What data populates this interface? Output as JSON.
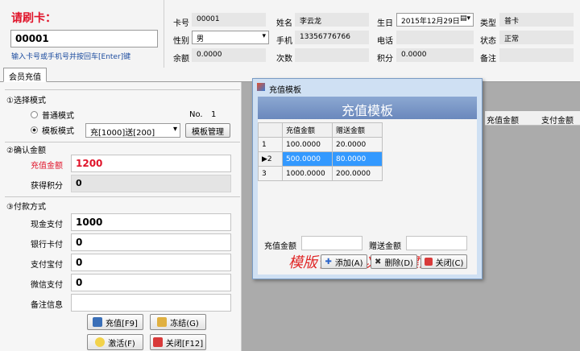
{
  "card": {
    "label": "请刷卡：",
    "number": "00001",
    "hint": "输入卡号或手机号并按回车[Enter]键"
  },
  "info": {
    "card_no_label": "卡号",
    "card_no": "00001",
    "name_label": "姓名",
    "name": "李云龙",
    "birthday_label": "生日",
    "birthday": "2015年12月29日",
    "type_label": "类型",
    "type": "普卡",
    "gender_label": "性别",
    "gender": "男",
    "phone_label": "手机",
    "phone": "13356776766",
    "tel_label": "电话",
    "tel": "",
    "status_label": "状态",
    "status": "正常",
    "balance_label": "余额",
    "balance": "0.0000",
    "times_label": "次数",
    "times": "",
    "points_label": "积分",
    "points": "0.0000",
    "note_label": "备注",
    "note": ""
  },
  "tab": {
    "label": "会员充值"
  },
  "mode": {
    "section": "①选择模式",
    "normal_label": "普通模式",
    "template_label": "模板模式",
    "no_label": "No.",
    "no_value": "1",
    "template_select": "充[1000]送[200]",
    "template_mgmt_button": "模板管理"
  },
  "amount": {
    "section": "②确认金额",
    "charge_label": "充值金额",
    "charge_value": "1200",
    "points_label": "获得积分",
    "points_value": "0"
  },
  "payment": {
    "section": "③付款方式",
    "cash_label": "现金支付",
    "cash_value": "1000",
    "bank_label": "银行卡付",
    "bank_value": "0",
    "alipay_label": "支付宝付",
    "alipay_value": "0",
    "wechat_label": "微信支付",
    "wechat_value": "0",
    "note_label": "备注信息",
    "note_value": ""
  },
  "buttons": {
    "recharge": "充值[F9]",
    "freeze": "冻结(G)",
    "activate": "激活(F)",
    "close": "关闭[F12]"
  },
  "grid": {
    "col_amount": "充值金额",
    "col_pay": "支付金额"
  },
  "dialog": {
    "title": "充值模板",
    "banner": "充值模板",
    "columns": [
      "充值金额",
      "赠送金额"
    ],
    "rows": [
      {
        "no": "1",
        "charge": "100.0000",
        "gift": "20.0000"
      },
      {
        "no": "2",
        "charge": "500.0000",
        "gift": "80.0000"
      },
      {
        "no": "3",
        "charge": "1000.0000",
        "gift": "200.0000"
      }
    ],
    "promo": "模版管理可以随时建立",
    "charge_label": "充值金额",
    "charge_value": "",
    "gift_label": "赠送金额",
    "gift_value": "",
    "add_button": "添加(A)",
    "delete_button": "删除(D)",
    "close_button": "关闭(C)"
  },
  "colors": {
    "accent_red": "#e0142a",
    "selected_row": "#3399ff",
    "banner": "#7a96c8"
  }
}
